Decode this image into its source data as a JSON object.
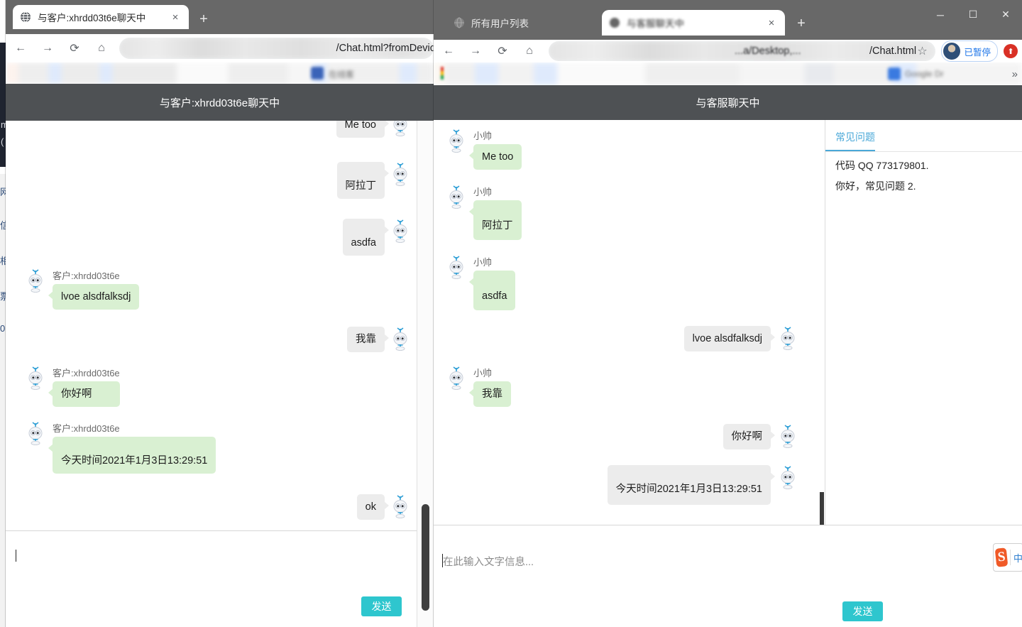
{
  "background_window": {
    "dark_text_lines": [
      "m",
      "("
    ],
    "list_chars": [
      "网",
      "信",
      "相",
      "票",
      "0"
    ]
  },
  "left_window": {
    "tab": {
      "title": "与客户:xhrdd03t6e聊天中",
      "favicon": "globe-icon",
      "close": "×"
    },
    "new_tab_label": "+",
    "toolbar": {
      "back": "←",
      "forward": "→",
      "reload": "⟳",
      "home": "⌂",
      "url_visible": "/Chat.html?fromDevic"
    },
    "app_header_title": "与客户:xhrdd03t6e聊天中",
    "messages": [
      {
        "side": "right",
        "bubble": "grey",
        "nick": "",
        "text": "Me too"
      },
      {
        "side": "right",
        "bubble": "grey",
        "nick": "",
        "text": "阿拉丁"
      },
      {
        "side": "right",
        "bubble": "grey",
        "nick": "",
        "text": "asdfa"
      },
      {
        "side": "left",
        "bubble": "green",
        "nick": "客户:xhrdd03t6e",
        "text": "lvoe  alsdfalksdj"
      },
      {
        "side": "right",
        "bubble": "grey",
        "nick": "",
        "text": "我靠"
      },
      {
        "side": "left",
        "bubble": "green",
        "nick": "客户:xhrdd03t6e",
        "text": "你好啊"
      },
      {
        "side": "left",
        "bubble": "green",
        "nick": "客户:xhrdd03t6e",
        "text": "今天时间2021年1月3日13:29:51"
      },
      {
        "side": "right",
        "bubble": "grey",
        "nick": "",
        "text": "ok"
      }
    ],
    "composer": {
      "placeholder": "",
      "send_label": "发送"
    }
  },
  "right_window": {
    "background_tab": {
      "title": "所有用户列表",
      "favicon": "globe-icon"
    },
    "active_tab": {
      "title": "与客服聊天中",
      "favicon": "globe-icon",
      "close": "×"
    },
    "new_tab_label": "+",
    "window_controls": {
      "minimize": "─",
      "maximize": "☐",
      "close": "✕"
    },
    "toolbar": {
      "back": "←",
      "forward": "→",
      "reload": "⟳",
      "home": "⌂",
      "url_prefix": "...a/Desktop,...",
      "url_suffix": "/Chat.html",
      "bookmark_star": "☆",
      "profile_label": "已暂停",
      "update_badge": "⬆",
      "overflow": "»"
    },
    "app_header_title": "与客服聊天中",
    "messages": [
      {
        "side": "left",
        "bubble": "green",
        "nick": "小帅",
        "text": "Me too"
      },
      {
        "side": "left",
        "bubble": "green",
        "nick": "小帅",
        "text": "阿拉丁"
      },
      {
        "side": "left",
        "bubble": "green",
        "nick": "小帅",
        "text": "asdfa"
      },
      {
        "side": "right",
        "bubble": "grey",
        "nick": "",
        "text": "lvoe  alsdfalksdj"
      },
      {
        "side": "left",
        "bubble": "green",
        "nick": "小帅",
        "text": "我靠"
      },
      {
        "side": "right",
        "bubble": "grey",
        "nick": "",
        "text": "你好啊"
      },
      {
        "side": "right",
        "bubble": "grey",
        "nick": "",
        "text": "今天时间2021年1月3日13:29:51"
      }
    ],
    "faq": {
      "tab_label": "常见问题",
      "items": [
        "代码 QQ 773179801.",
        "你好，常见问题 2."
      ]
    },
    "composer": {
      "placeholder": "在此输入文字信息...",
      "send_label": "发送"
    }
  },
  "ime": {
    "logo": "S",
    "char": "中"
  },
  "colors": {
    "accent_send": "#2ec6ce",
    "header_bar": "#4e5154",
    "bubble_green": "#d9f0d2",
    "bubble_grey": "#ececec",
    "faq_blue": "#4aa8d8",
    "tabstrip": "#686868"
  }
}
